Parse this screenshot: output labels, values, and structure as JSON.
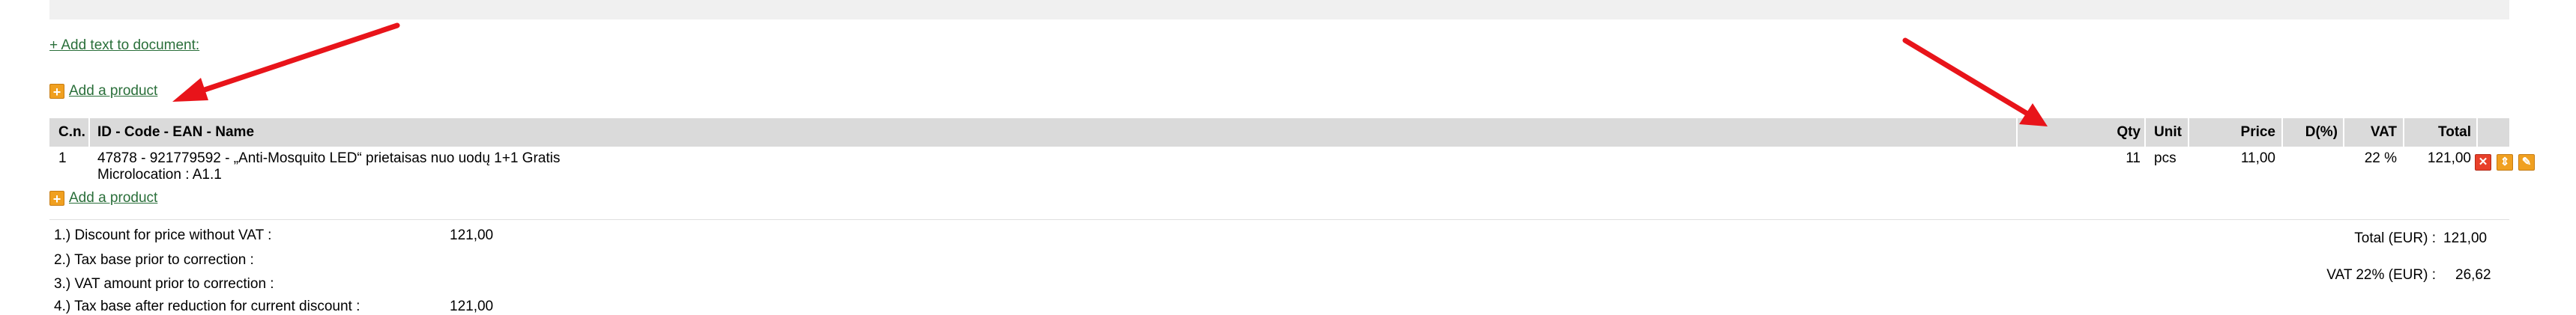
{
  "links": {
    "add_text": "+ Add text to document:",
    "add_product": "Add a product"
  },
  "icons": {
    "add_product": "plus-box-icon",
    "delete": "delete-icon",
    "move": "move-up-down-icon",
    "edit": "edit-icon"
  },
  "colors": {
    "link": "#2a6f3a",
    "arrow": "#e8141a",
    "header_bg": "#dadada",
    "action_orange": "#f0a020",
    "action_red": "#e8402a"
  },
  "table": {
    "headers": {
      "cn": "C.n.",
      "name": "ID - Code - EAN - Name",
      "qty": "Qty",
      "unit": "Unit",
      "price": "Price",
      "discount": "D(%)",
      "vat": "VAT",
      "total": "Total"
    },
    "rows": [
      {
        "cn": "1",
        "name": "47878 - 921779592 - „Anti-Mosquito LED“ prietaisas nuo uodų 1+1 Gratis",
        "location": "Microlocation : A1.1",
        "qty": "11",
        "unit": "pcs",
        "price": "11,00",
        "discount": "",
        "vat": "22 %",
        "total": "121,00"
      }
    ]
  },
  "summary": {
    "line1_label": "1.) Discount for price without VAT :",
    "line1_value": "121,00",
    "line2_label": "2.) Tax base prior to correction :",
    "line3_label": "3.) VAT amount prior to correction :",
    "line4_label": "4.) Tax base after reduction for current discount :",
    "line4_value": "121,00",
    "total_label": "Total (EUR) :",
    "total_value": "121,00",
    "vat_label": "VAT 22% (EUR) :",
    "vat_value": "26,62"
  }
}
